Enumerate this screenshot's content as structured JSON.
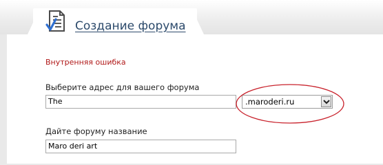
{
  "header": {
    "title": "Создание форума",
    "icon": "document-check-icon"
  },
  "form": {
    "error_message": "Внутренняя ошибка",
    "address_label": "Выберите адрес для вашего форума",
    "address_value": "The",
    "domain_selected": ".maroderi.ru",
    "name_label": "Дайте форуму название",
    "name_value": "Maro deri art"
  },
  "colors": {
    "title": "#2c4a6b",
    "error": "#b01818",
    "highlight_ring": "#c8202a"
  }
}
